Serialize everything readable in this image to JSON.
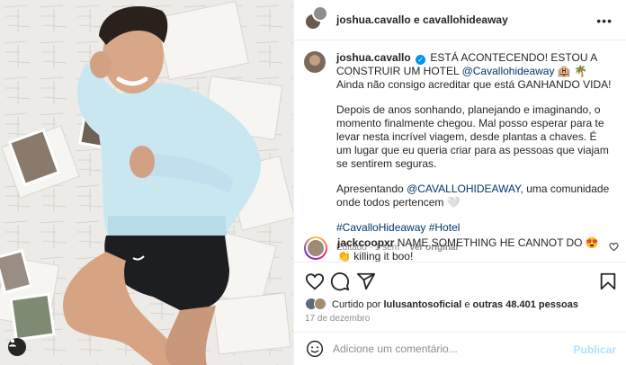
{
  "header": {
    "names": "joshua.cavallo e cavallohideaway",
    "more_icon": "ellipsis-icon"
  },
  "caption": {
    "username": "joshua.cavallo",
    "line1_text": "ESTÁ ACONTECENDO! ESTOU A CONSTRUIR UM HOTEL",
    "mention_hotel": "@Cavallohideaway",
    "line1_emoji": "🏨 🌴",
    "line2": "Ainda não consigo acreditar que está GANHANDO VIDA!",
    "para2": "Depois de anos sonhando, planejando e imaginando, o momento finalmente chegou. Mal posso esperar para te levar nesta incrível viagem, desde plantas a chaves. É um lugar que eu queria criar para as pessoas que viajam se sentirem seguras.",
    "para3_prefix": "Apresentando",
    "para3_mention": "@CAVALLOHIDEAWAY",
    "para3_suffix": ", uma comunidade onde todos pertencem 🤍",
    "hashtags": "#CavalloHideaway #Hotel",
    "edited": "Editado · 1 sem",
    "see_original": "Ver original"
  },
  "comment": {
    "username": "jackcoopxr",
    "text": "NAME SOMETHING HE CANNOT DO 😍 👏 killing it boo!"
  },
  "likes": {
    "prefix": "Curtido por",
    "user": "lulusantosoficial",
    "middle": "e",
    "others": "outras 48.401 pessoas"
  },
  "date": "17 de dezembro",
  "add_comment": {
    "placeholder": "Adicione um comentário...",
    "post_label": "Publicar"
  },
  "colors": {
    "link": "#00376b",
    "verified": "#0095f6",
    "post_disabled": "#b2dffc",
    "secondary_text": "#8e8e8e"
  }
}
